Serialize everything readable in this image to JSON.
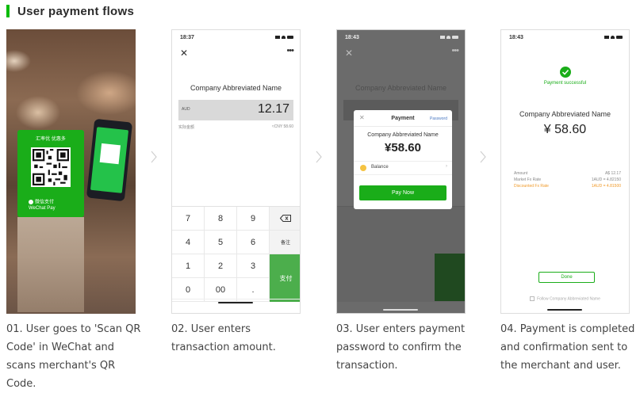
{
  "header": {
    "title": "User payment flows",
    "accent_color": "#09bb07"
  },
  "steps": [
    {
      "caption": "01. User goes to 'Scan QR Code' in WeChat and scans merchant's QR Code.",
      "stand_header": "汇率优 优惠多",
      "stand_footer": "微信支付",
      "stand_footer_en": "WeChat Pay"
    },
    {
      "caption": "02. User enters transaction amount.",
      "time": "18:37",
      "company": "Company Abbreviated Name",
      "currency": "AUD",
      "amount": "12.17",
      "sub_left": "实际金额",
      "sub_right": "≈CNY 58.60",
      "keys": [
        "7",
        "8",
        "9",
        "4",
        "5",
        "6",
        "1",
        "2",
        "3",
        "0",
        "00",
        "."
      ],
      "remark_label": "备注",
      "pay_label": "支付"
    },
    {
      "caption": "03. User enters payment password to confirm the transaction.",
      "time": "18:43",
      "modal_title": "Payment",
      "modal_password": "Password",
      "company": "Company Abbreviated Name",
      "amount": "¥58.60",
      "balance_label": "Balance",
      "pay_now": "Pay Now"
    },
    {
      "caption": "04. Payment is completed and confirmation sent to the merchant and user.",
      "time": "18:43",
      "success": "Payment successful",
      "company": "Company Abbreviated Name",
      "amount": "¥ 58.60",
      "rows": [
        {
          "label": "Amount",
          "value": "A$ 12.17"
        },
        {
          "label": "Market Fx Rate",
          "value": "1AUD = 4.82150"
        },
        {
          "label": "Discounted Fx Rate",
          "value": "1AUD = 4.81500"
        }
      ],
      "done": "Done",
      "follow": "Follow Company Abbreviated Name"
    }
  ]
}
